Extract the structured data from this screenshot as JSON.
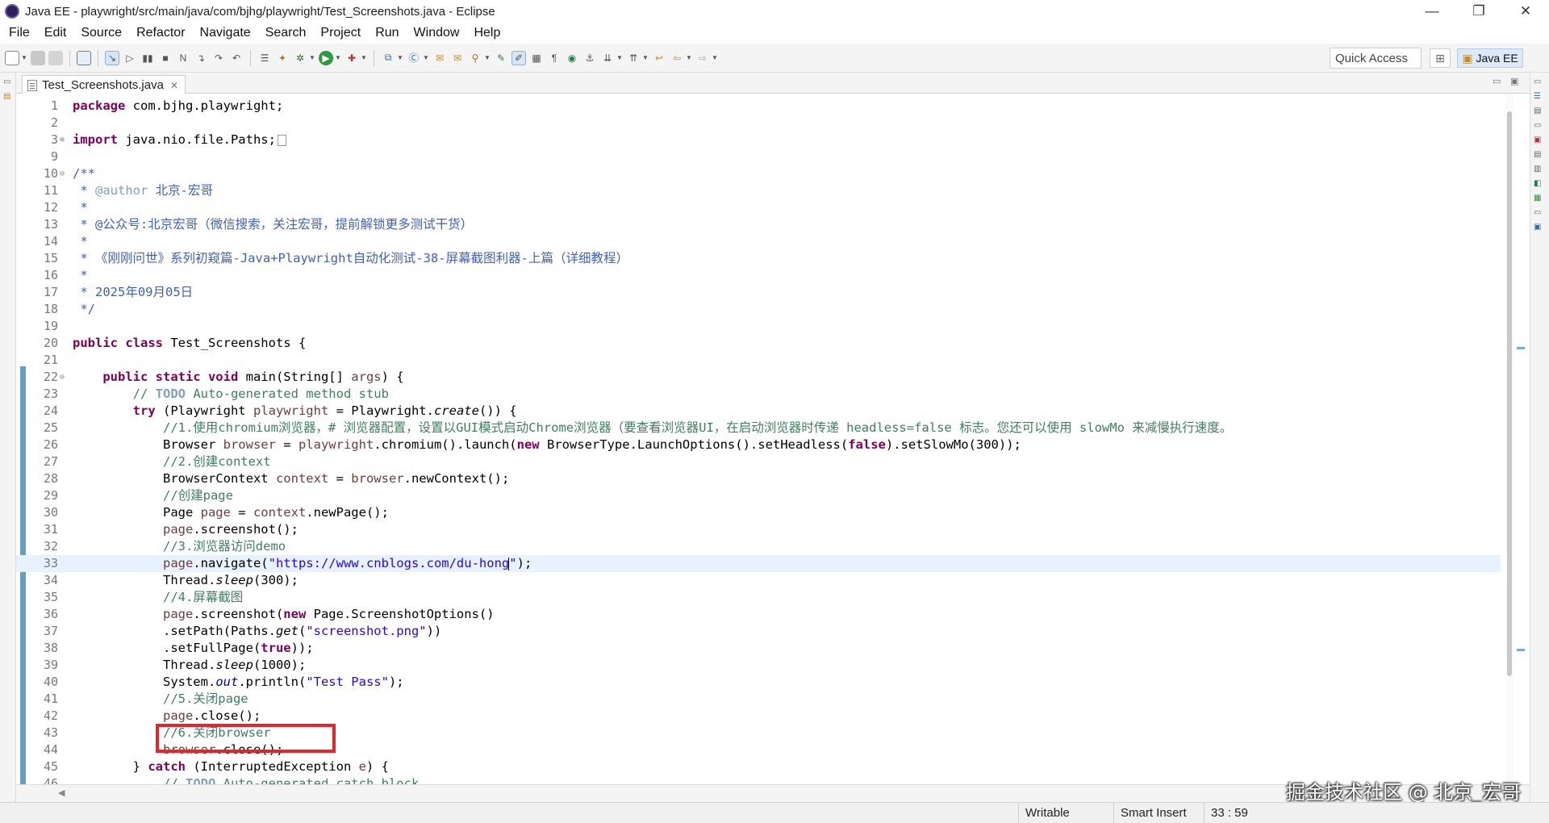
{
  "window": {
    "title": "Java EE - playwright/src/main/java/com/bjhg/playwright/Test_Screenshots.java - Eclipse",
    "minimize": "—",
    "maximize": "❐",
    "close": "✕"
  },
  "menu": [
    "File",
    "Edit",
    "Source",
    "Refactor",
    "Navigate",
    "Search",
    "Project",
    "Run",
    "Window",
    "Help"
  ],
  "toolbar": {
    "quick_access": "Quick Access",
    "perspective": "Java EE"
  },
  "editor": {
    "tab_label": "Test_Screenshots.java",
    "tab_close": "✕",
    "current_line": 33
  },
  "code_lines": [
    {
      "n": "1",
      "text": "package com.bjhg.playwright;"
    },
    {
      "n": "2",
      "text": ""
    },
    {
      "n": "3",
      "text": "import java.nio.file.Paths;"
    },
    {
      "n": "9",
      "text": ""
    },
    {
      "n": "10",
      "text": "/**"
    },
    {
      "n": "11",
      "text": " * @author 北京-宏哥"
    },
    {
      "n": "12",
      "text": " *"
    },
    {
      "n": "13",
      "text": " * @公众号:北京宏哥（微信搜索，关注宏哥，提前解锁更多测试干货）"
    },
    {
      "n": "14",
      "text": " *"
    },
    {
      "n": "15",
      "text": " * 《刚刚问世》系列初窥篇-Java+Playwright自动化测试-38-屏幕截图利器-上篇（详细教程）"
    },
    {
      "n": "16",
      "text": " *"
    },
    {
      "n": "17",
      "text": " * 2025年09月05日"
    },
    {
      "n": "18",
      "text": " */"
    },
    {
      "n": "19",
      "text": ""
    },
    {
      "n": "20",
      "text": "public class Test_Screenshots {"
    },
    {
      "n": "21",
      "text": ""
    },
    {
      "n": "22",
      "text": "    public static void main(String[] args) {"
    },
    {
      "n": "23",
      "text": "        // TODO Auto-generated method stub"
    },
    {
      "n": "24",
      "text": "        try (Playwright playwright = Playwright.create()) {"
    },
    {
      "n": "25",
      "text": "            //1.使用chromium浏览器，# 浏览器配置，设置以GUI模式启动Chrome浏览器（要查看浏览器UI，在启动浏览器时传递 headless=false 标志。您还可以使用 slowMo 来减慢执行速度。"
    },
    {
      "n": "26",
      "text": "            Browser browser = playwright.chromium().launch(new BrowserType.LaunchOptions().setHeadless(false).setSlowMo(300));"
    },
    {
      "n": "27",
      "text": "            //2.创建context"
    },
    {
      "n": "28",
      "text": "            BrowserContext context = browser.newContext();"
    },
    {
      "n": "29",
      "text": "            //创建page"
    },
    {
      "n": "30",
      "text": "            Page page = context.newPage();"
    },
    {
      "n": "31",
      "text": "            page.screenshot();"
    },
    {
      "n": "32",
      "text": "            //3.浏览器访问demo"
    },
    {
      "n": "33",
      "text": "            page.navigate(\"https://www.cnblogs.com/du-hong\");"
    },
    {
      "n": "34",
      "text": "            Thread.sleep(300);"
    },
    {
      "n": "35",
      "text": "            //4.屏幕截图"
    },
    {
      "n": "36",
      "text": "            page.screenshot(new Page.ScreenshotOptions()"
    },
    {
      "n": "37",
      "text": "            .setPath(Paths.get(\"screenshot.png\"))"
    },
    {
      "n": "38",
      "text": "            .setFullPage(true));"
    },
    {
      "n": "39",
      "text": "            Thread.sleep(1000);"
    },
    {
      "n": "40",
      "text": "            System.out.println(\"Test Pass\");"
    },
    {
      "n": "41",
      "text": "            //5.关闭page"
    },
    {
      "n": "42",
      "text": "            page.close();"
    },
    {
      "n": "43",
      "text": "            //6.关闭browser"
    },
    {
      "n": "44",
      "text": "            browser.close();"
    },
    {
      "n": "45",
      "text": "        } catch (InterruptedException e) {"
    },
    {
      "n": "46",
      "text": "            // TODO Auto-generated catch block"
    }
  ],
  "status": {
    "writable": "Writable",
    "insert_mode": "Smart Insert",
    "position": "33 : 59"
  },
  "watermark": "掘金技术社区 @ 北京_宏哥",
  "colors": {
    "keyword": "#7f0055",
    "comment": "#3f7f5f",
    "javadoc": "#3f5fbf",
    "string": "#2a00ff",
    "highlight_box": "#e8242a",
    "current_line": "#e8f2fe"
  }
}
